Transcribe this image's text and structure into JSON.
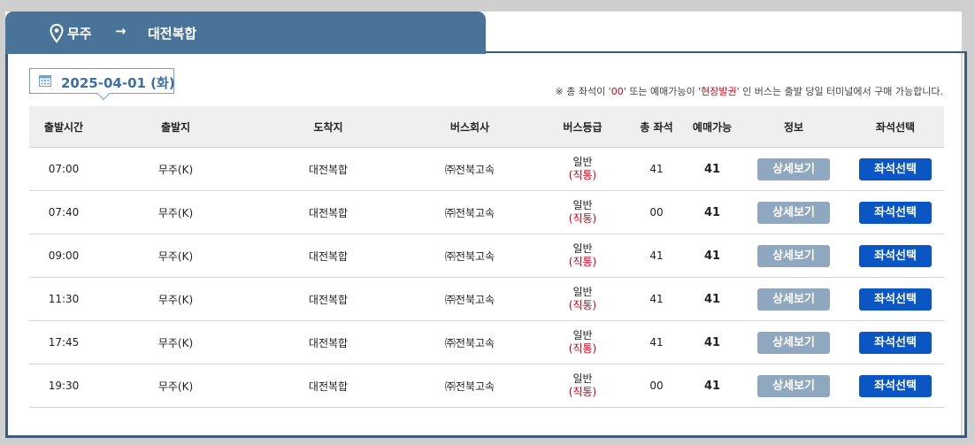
{
  "route": {
    "from": "무주",
    "arrow": "→",
    "to": "대전복합"
  },
  "date": {
    "text": "2025-04-01 (화)"
  },
  "notice": {
    "prefix": "※ 총 좌석이 '",
    "hl1": "00",
    "mid": "' 또는 예매가능이 '",
    "hl2": "현장발권",
    "suffix": "' 인 버스는 출발 당일 터미널에서 구매 가능합니다."
  },
  "columns": [
    "출발시간",
    "출발지",
    "도착지",
    "버스회사",
    "버스등급",
    "총 좌석",
    "예매가능",
    "정보",
    "좌석선택"
  ],
  "buttons": {
    "detail": "상세보기",
    "seat": "좌석선택"
  },
  "rows": [
    {
      "time": "07:00",
      "origin": "무주(K)",
      "dest": "대전복합",
      "company": "㈜전북고속",
      "grade": "일반",
      "grade_note": "(직통)",
      "total": "41",
      "avail": "41"
    },
    {
      "time": "07:40",
      "origin": "무주(K)",
      "dest": "대전복합",
      "company": "㈜전북고속",
      "grade": "일반",
      "grade_note": "(직통)",
      "total": "00",
      "avail": "41"
    },
    {
      "time": "09:00",
      "origin": "무주(K)",
      "dest": "대전복합",
      "company": "㈜전북고속",
      "grade": "일반",
      "grade_note": "(직통)",
      "total": "41",
      "avail": "41"
    },
    {
      "time": "11:30",
      "origin": "무주(K)",
      "dest": "대전복합",
      "company": "㈜전북고속",
      "grade": "일반",
      "grade_note": "(직통)",
      "total": "41",
      "avail": "41"
    },
    {
      "time": "17:45",
      "origin": "무주(K)",
      "dest": "대전복합",
      "company": "㈜전북고속",
      "grade": "일반",
      "grade_note": "(직통)",
      "total": "41",
      "avail": "41"
    },
    {
      "time": "19:30",
      "origin": "무주(K)",
      "dest": "대전복합",
      "company": "㈜전북고속",
      "grade": "일반",
      "grade_note": "(직통)",
      "total": "00",
      "avail": "41"
    }
  ]
}
